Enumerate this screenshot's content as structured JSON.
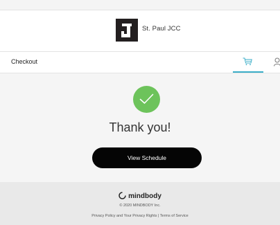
{
  "brand": {
    "name": "St. Paul JCC"
  },
  "nav": {
    "title": "Checkout",
    "cart_icon": "cart-icon",
    "user_icon": "user-icon",
    "accent": "#3aaec8"
  },
  "confirmation": {
    "icon": "check-icon",
    "color": "#6dc35b",
    "message": "Thank you!",
    "button_label": "View Schedule"
  },
  "footer": {
    "logo_text": "mindbody",
    "copyright": "© 2020 MINDBODY Inc.",
    "privacy_link": "Privacy Policy and Your Privacy Rights",
    "separator": " | ",
    "terms_link": "Terms of Service"
  }
}
